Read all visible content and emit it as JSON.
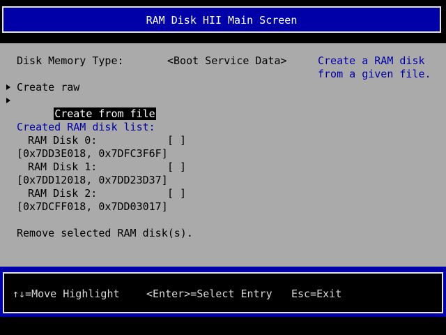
{
  "window": {
    "title": "RAM Disk HII Main Screen"
  },
  "form": {
    "memory_type_label": "Disk Memory Type:",
    "memory_type_value": "<Boot Service Data>",
    "help_text_line1": "Create a RAM disk",
    "help_text_line2": "from a given file.",
    "create_raw_label": "Create raw",
    "create_from_file_label": "Create from file",
    "list_heading": "Created RAM disk list:",
    "disks": [
      {
        "name": "RAM Disk 0:",
        "checkbox": "[ ]",
        "range": "[0x7DD3E018, 0x7DFC3F6F]"
      },
      {
        "name": "RAM Disk 1:",
        "checkbox": "[ ]",
        "range": "[0x7DD12018, 0x7DD23D37]"
      },
      {
        "name": "RAM Disk 2:",
        "checkbox": "[ ]",
        "range": "[0x7DCFF018, 0x7DD03017]"
      }
    ],
    "remove_label": "Remove selected RAM disk(s)."
  },
  "footer": {
    "move_hint": "↑↓=Move Highlight",
    "select_hint": "<Enter>=Select Entry",
    "exit_hint": "Esc=Exit"
  },
  "colors": {
    "title_bg": "#0000a8",
    "body_bg": "#aaaaaa",
    "help_text": "#0000a8",
    "highlight_bg": "#000000",
    "highlight_fg": "#ffffff"
  }
}
